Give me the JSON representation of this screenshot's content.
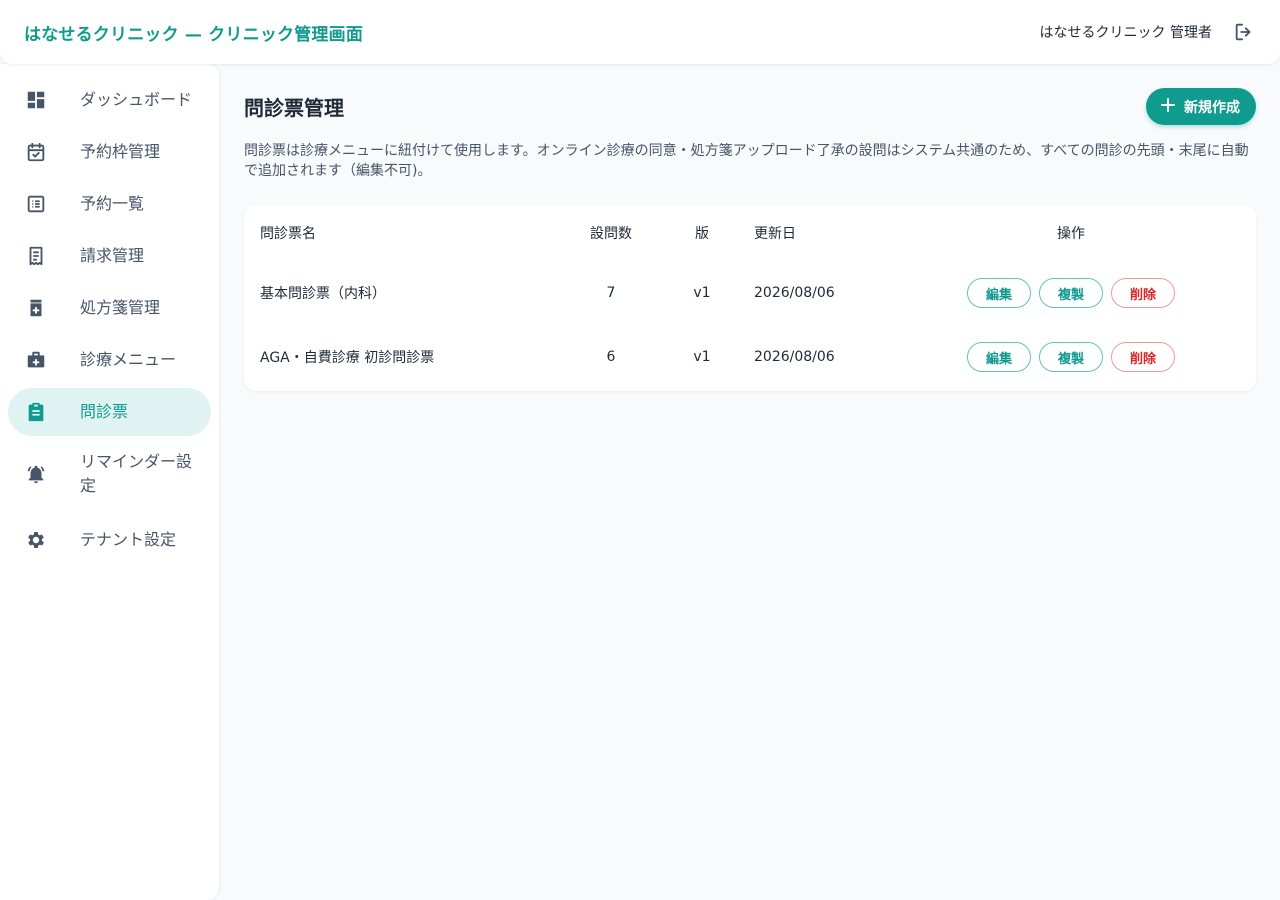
{
  "header": {
    "title": "はなせるクリニック — クリニック管理画面",
    "admin_name": "はなせるクリニック 管理者",
    "logout_icon": "logout-icon"
  },
  "sidebar": {
    "items": [
      {
        "label": "ダッシュボード",
        "icon": "dashboard-icon",
        "active": false
      },
      {
        "label": "予約枠管理",
        "icon": "calendar-check-icon",
        "active": false
      },
      {
        "label": "予約一覧",
        "icon": "list-icon",
        "active": false
      },
      {
        "label": "請求管理",
        "icon": "receipt-icon",
        "active": false
      },
      {
        "label": "処方箋管理",
        "icon": "medication-icon",
        "active": false
      },
      {
        "label": "診療メニュー",
        "icon": "medical-bag-icon",
        "active": false
      },
      {
        "label": "問診票",
        "icon": "clipboard-icon",
        "active": true
      },
      {
        "label": "リマインダー設定",
        "icon": "bell-icon",
        "active": false
      },
      {
        "label": "テナント設定",
        "icon": "gear-icon",
        "active": false
      }
    ]
  },
  "main": {
    "title": "問診票管理",
    "new_button": "新規作成",
    "description": "問診票は診療メニューに紐付けて使用します。オンライン診療の同意・処方箋アップロード了承の設問はシステム共通のため、すべての問診の先頭・末尾に自動で追加されます（編集不可)。",
    "table": {
      "headers": {
        "name": "問診票名",
        "count": "設問数",
        "version": "版",
        "updated": "更新日",
        "actions": "操作"
      },
      "rows": [
        {
          "name": "基本問診票（内科）",
          "count": "7",
          "version": "v1",
          "updated": "2026/08/06"
        },
        {
          "name": "AGA・自費診療 初診問診票",
          "count": "6",
          "version": "v1",
          "updated": "2026/08/06"
        }
      ],
      "actions": {
        "edit": "編集",
        "copy": "複製",
        "delete": "削除"
      }
    }
  },
  "colors": {
    "accent": "#0f9b8e",
    "active_bg": "#e0f2f1",
    "danger": "#dc2626",
    "nav_icon": "#475569"
  }
}
